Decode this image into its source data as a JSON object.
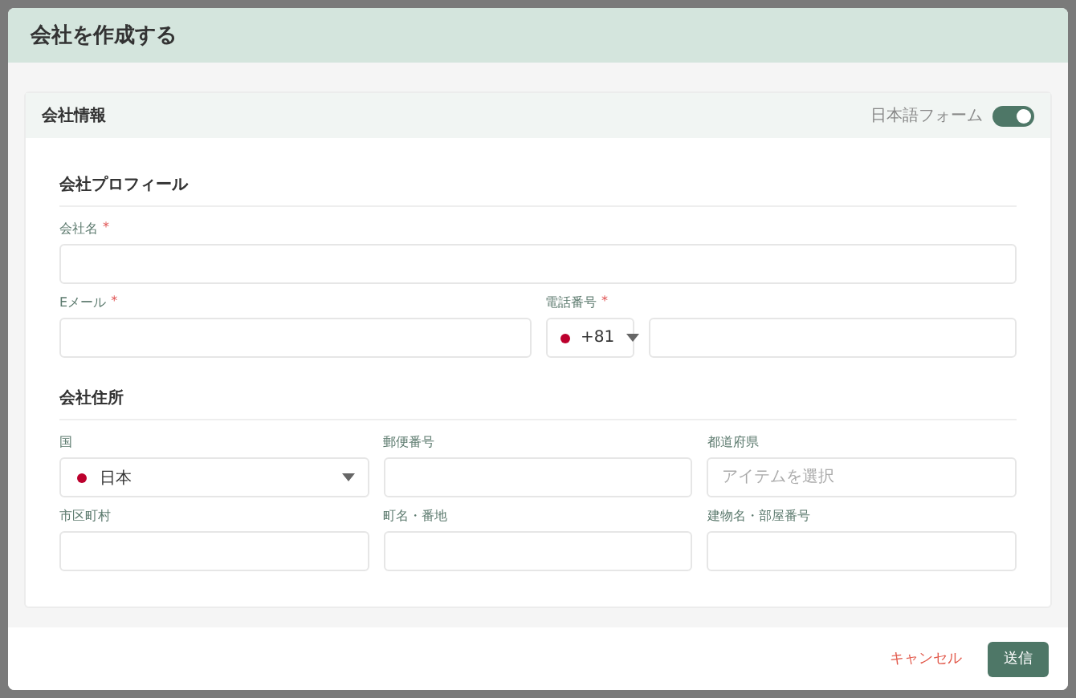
{
  "dialog": {
    "title": "会社を作成する"
  },
  "card": {
    "title": "会社情報",
    "toggle": {
      "label": "日本語フォーム",
      "on": true
    }
  },
  "sections": [
    {
      "heading": "会社プロフィール",
      "rows": [
        [
          {
            "kind": "text",
            "label": "会社名",
            "required_mark": "*"
          }
        ],
        [
          {
            "kind": "text",
            "label": "Eメール",
            "required_mark": "*"
          },
          {
            "kind": "phone",
            "label": "電話番号",
            "required_mark": "*",
            "code": "+81"
          }
        ]
      ]
    },
    {
      "heading": "会社住所",
      "rows": [
        [
          {
            "kind": "select",
            "label": "国",
            "value": "日本"
          },
          {
            "kind": "text",
            "label": "郵便番号"
          },
          {
            "kind": "text",
            "label": "都道府県",
            "placeholder": "アイテムを選択"
          }
        ],
        [
          {
            "kind": "text",
            "label": "市区町村"
          },
          {
            "kind": "text",
            "label": "町名・番地"
          },
          {
            "kind": "text",
            "label": "建物名・部屋番号"
          }
        ]
      ]
    }
  ],
  "buttons": [
    {
      "kind": "secondary",
      "label": "キャンセル"
    },
    {
      "kind": "primary",
      "label": "送信"
    }
  ]
}
